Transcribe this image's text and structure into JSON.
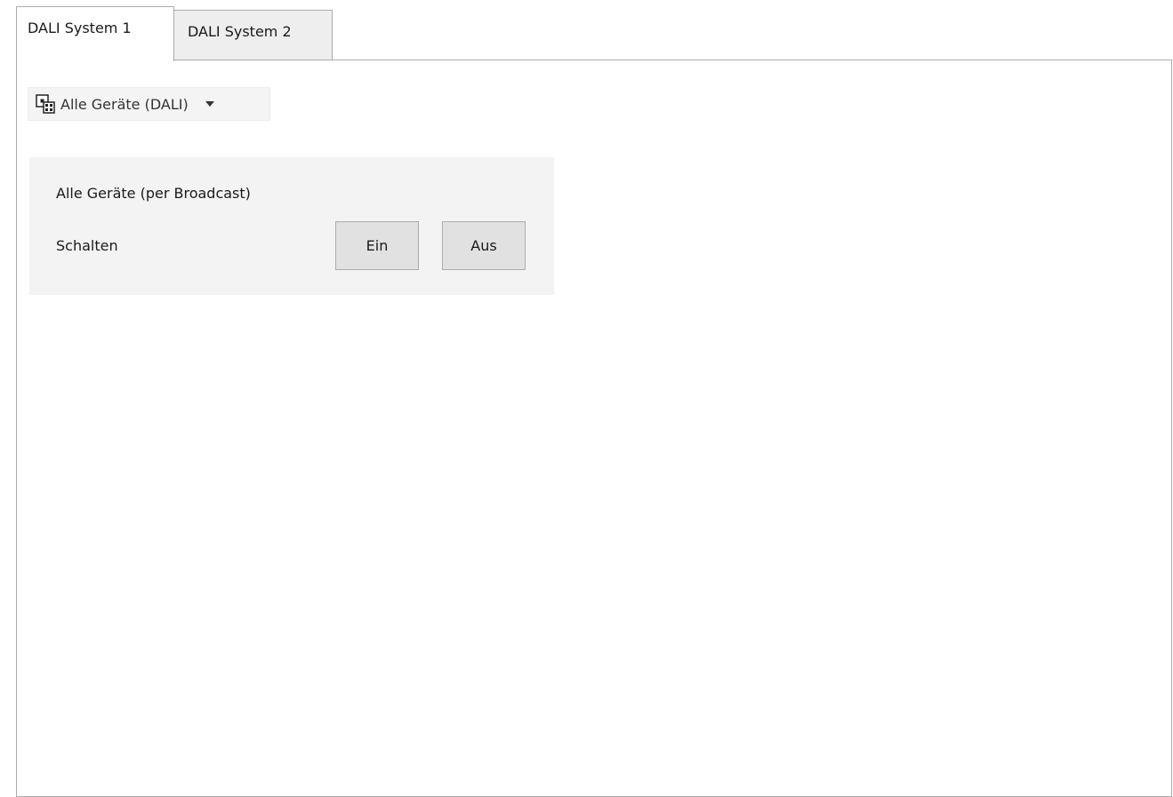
{
  "tabs": [
    {
      "label": "DALI System 1",
      "active": true
    },
    {
      "label": "DALI System 2",
      "active": false
    }
  ],
  "device_selector": {
    "icon": "device-group-icon",
    "selected": "Alle Geräte (DALI)"
  },
  "broadcast_group": {
    "title": "Alle Geräte (per Broadcast)",
    "switch_label": "Schalten",
    "on_label": "Ein",
    "off_label": "Aus"
  },
  "colors": {
    "panel_border": "#acacac",
    "group_background": "#f3f3f3",
    "button_background": "#e1e1e1"
  }
}
